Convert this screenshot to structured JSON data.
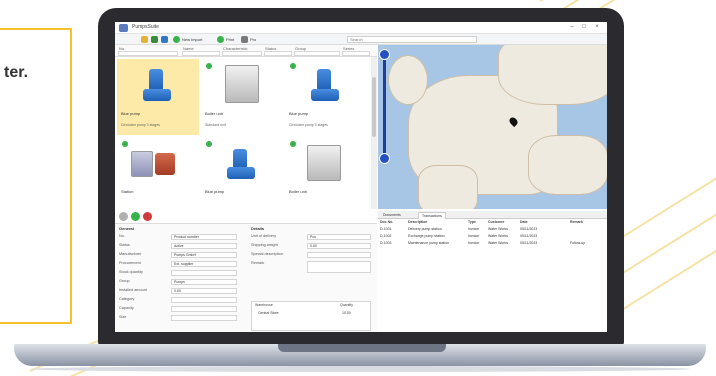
{
  "callout": {
    "text": "ter."
  },
  "app": {
    "title": "PumpsSuite",
    "window_controls": [
      "–",
      "□",
      "×"
    ]
  },
  "toolbar": {
    "items": [
      {
        "icon": "folder-icon",
        "color": "#e2b43a",
        "label": ""
      },
      {
        "icon": "save-icon",
        "color": "#3d8a3d",
        "label": ""
      },
      {
        "icon": "refresh-icon",
        "color": "#2f78c4",
        "label": ""
      },
      {
        "icon": "add-icon",
        "color": "#37b34a",
        "label": "New Import"
      },
      {
        "icon": "print-icon",
        "color": "#37b34a",
        "label": "Print"
      },
      {
        "icon": "help-icon",
        "color": "#7a7a7a",
        "label": "Pro"
      }
    ],
    "search_placeholder": "Search"
  },
  "filters": {
    "columns": [
      "No.",
      "Name",
      "Characteristic",
      "Status",
      "Group",
      "Series"
    ]
  },
  "grid": {
    "cards": [
      {
        "name": "Blue pump",
        "sub": "Circulator pump 3 stages",
        "type": "pump",
        "selected": true,
        "dot": false
      },
      {
        "name": "Boiler unit",
        "sub": "Standard unit",
        "type": "boiler",
        "selected": false,
        "dot": true
      },
      {
        "name": "Blue pump",
        "sub": "Circulator pump 3 stages",
        "type": "pump",
        "selected": false,
        "dot": true
      },
      {
        "name": "Station",
        "sub": "",
        "type": "station",
        "selected": false,
        "dot": true
      },
      {
        "name": "Blue pump",
        "sub": "",
        "type": "pump",
        "selected": false,
        "dot": true
      },
      {
        "name": "Boiler unit",
        "sub": "",
        "type": "boiler",
        "selected": false,
        "dot": true
      }
    ]
  },
  "form": {
    "actions": [
      {
        "icon": "edit-icon",
        "color": "#9a9a9a"
      },
      {
        "icon": "add-icon",
        "color": "#37b34a"
      },
      {
        "icon": "delete-icon",
        "color": "#d23b3b"
      }
    ],
    "left_section": "General",
    "left_fields": [
      {
        "label": "No.",
        "value": "Product number"
      },
      {
        "label": "Status",
        "value": "Active"
      },
      {
        "label": "Manufacturer",
        "value": "Pumps GmbH"
      },
      {
        "label": "Procurement",
        "value": "Ext. supplier"
      },
      {
        "label": "Stock quantity",
        "value": ""
      },
      {
        "label": "Group",
        "value": "Pumps"
      },
      {
        "label": "Installed amount",
        "value": "0.00"
      },
      {
        "label": "Category",
        "value": ""
      },
      {
        "label": "Capacity",
        "value": ""
      },
      {
        "label": "Size",
        "value": ""
      }
    ],
    "right_section": "Details",
    "right_fields": [
      {
        "label": "Unit of delivery",
        "value": "Pcs"
      },
      {
        "label": "Shipping weight",
        "value": "0.00"
      },
      {
        "label": "Special description",
        "value": ""
      },
      {
        "label": "Remark",
        "value": ""
      }
    ],
    "subtable": {
      "headers": [
        "Warehouse",
        "Quantity"
      ],
      "rows": [
        [
          "Central Store",
          "10.00"
        ]
      ]
    }
  },
  "right_panel": {
    "tabs": [
      "Documents",
      "Transactions"
    ],
    "active_tab": 1,
    "headers": [
      "Doc No.",
      "Description",
      "Type",
      "Customer",
      "Date",
      "Remark"
    ],
    "rows": [
      [
        "D-1001",
        "Delivery pump station",
        "Invoice",
        "Water Works",
        "05/11/2023",
        ""
      ],
      [
        "D-1002",
        "Exchange pump station",
        "Invoice",
        "Water Works",
        "05/11/2023",
        ""
      ],
      [
        "D-1003",
        "Maintenance pump station",
        "Invoice",
        "Water Works",
        "05/11/2023",
        "Follow-up"
      ]
    ]
  },
  "colors": {
    "accent_yellow": "#f2c230",
    "selection": "#fde9a8",
    "status_green": "#37b34a",
    "map_water": "#a7c6e6"
  }
}
